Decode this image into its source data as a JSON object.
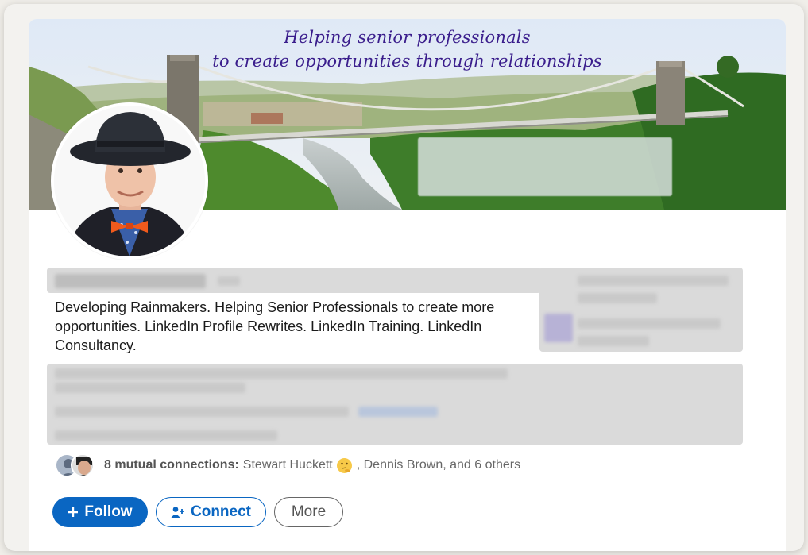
{
  "banner": {
    "tagline_line1": "Helping senior professionals",
    "tagline_line2": "to create opportunities through relationships"
  },
  "profile": {
    "headline": "Developing Rainmakers. Helping Senior Professionals to create more opportunities. LinkedIn Profile Rewrites. LinkedIn Training. LinkedIn Consultancy."
  },
  "mutual": {
    "count_label": "8 mutual connections:",
    "first_name": "Stewart Huckett",
    "rest": ", Dennis Brown, and 6 others"
  },
  "actions": {
    "follow_label": "Follow",
    "connect_label": "Connect",
    "more_label": "More"
  },
  "colors": {
    "brand_blue": "#0a66c2",
    "tagline_purple": "#3a1d8c"
  },
  "icons": [
    "plus-icon",
    "add-person-icon",
    "thinking-face-emoji"
  ]
}
